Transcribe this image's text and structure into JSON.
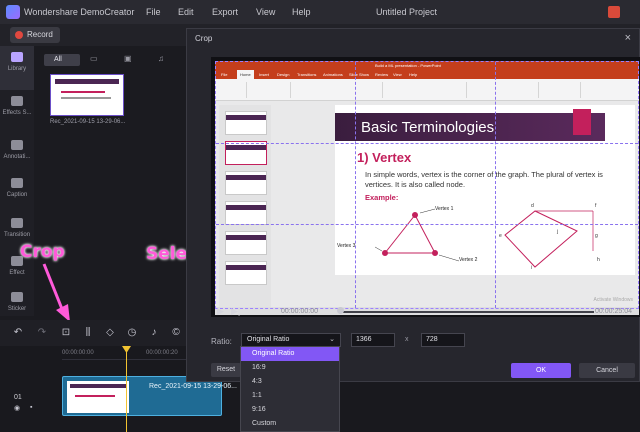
{
  "app": {
    "title": "Wondershare DemoCreator",
    "project_title": "Untitled Project",
    "menu": [
      "File",
      "Edit",
      "Export",
      "View",
      "Help"
    ],
    "record_label": "Record"
  },
  "sidebar": {
    "items": [
      {
        "label": "Library",
        "icon": "library-icon",
        "active": true
      },
      {
        "label": "Effects S...",
        "icon": "effects-icon",
        "active": false
      },
      {
        "label": "Annotati...",
        "icon": "annotation-icon",
        "active": false
      },
      {
        "label": "Caption",
        "icon": "caption-icon",
        "active": false
      },
      {
        "label": "Transition",
        "icon": "transition-icon",
        "active": false
      },
      {
        "label": "Effect",
        "icon": "effect-icon",
        "active": false
      },
      {
        "label": "Sticker",
        "icon": "sticker-icon",
        "active": false
      }
    ]
  },
  "media": {
    "all_tab": "All",
    "thumbnail_name": "Rec_2021-09-15 13-29-06..."
  },
  "annotations": {
    "crop": "Crop",
    "select_ratio": "Select Ratio"
  },
  "timeline": {
    "track_number": "01",
    "clip_label": "Rec_2021-09-15 13-29-06...",
    "ruler_start": "00:00:00:00",
    "ruler_mark": "00:00:00:20"
  },
  "crop_dialog": {
    "title": "Crop",
    "close": "×",
    "player": {
      "current_time": "00:00:00:00",
      "total_time": "00:00:25:04"
    },
    "ratio_label": "Ratio:",
    "ratio_selected": "Original Ratio",
    "width": "1366",
    "height": "728",
    "times_sign": "x",
    "reset_label": "Reset",
    "ok_label": "OK",
    "cancel_label": "Cancel",
    "ratio_options": [
      "Original Ratio",
      "16:9",
      "4:3",
      "1:1",
      "9:16",
      "Custom"
    ]
  },
  "slide": {
    "window_title": "Build a ML presentation - PowerPoint",
    "tabs": [
      "File",
      "Home",
      "Insert",
      "Design",
      "Transitions",
      "Animations",
      "Slide Show",
      "Review",
      "View",
      "Help"
    ],
    "title": "Basic Terminologies",
    "heading": "1) Vertex",
    "body": "In simple words, vertex is the corner of the graph. The plural of vertex is vertices. It is also called node.",
    "example": "Example:",
    "labels": [
      "Vertex 1",
      "Vertex 3",
      "Vertex 2"
    ],
    "letters": [
      "d",
      "f",
      "e",
      "j",
      "g",
      "i",
      "h"
    ],
    "watermark": "Activate Windows"
  },
  "colors": {
    "accent": "#8257f5",
    "annotation": "#ff5ad9",
    "slide_accent": "#c3205c",
    "ppt_red": "#c43e1c"
  }
}
